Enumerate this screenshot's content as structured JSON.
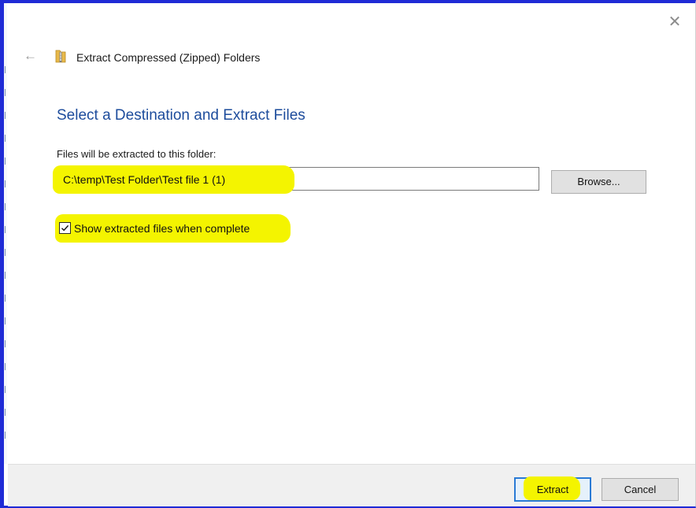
{
  "window": {
    "title": "Extract Compressed (Zipped) Folders",
    "close_glyph": "✕",
    "back_glyph": "←"
  },
  "main": {
    "heading": "Select a Destination and Extract Files",
    "folder_label": "Files will be extracted to this folder:",
    "path_value": "C:\\temp\\Test Folder\\Test file 1 (1)",
    "browse_label": "Browse...",
    "show_files_label": "Show extracted files when complete",
    "show_files_checked": true
  },
  "footer": {
    "extract_label": "Extract",
    "cancel_label": "Cancel"
  },
  "colors": {
    "heading": "#1d4c9c",
    "highlight": "#f4f400",
    "primary_button_border": "#2a7ad5",
    "window_border": "#1f2bd6"
  },
  "icons": {
    "title": "zip-folder-icon",
    "back": "back-arrow-icon",
    "close": "close-icon",
    "checkbox": "checkmark-icon"
  }
}
